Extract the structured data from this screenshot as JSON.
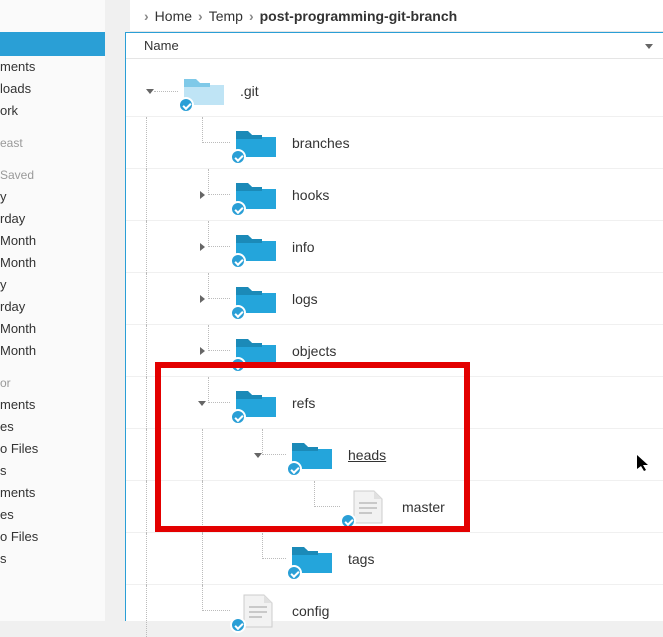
{
  "breadcrumb": {
    "items": [
      "Home",
      "Temp",
      "post-programming-git-branch"
    ]
  },
  "sidebar": {
    "sel": "",
    "g1": [
      "ments",
      "loads",
      "ork"
    ],
    "h1": "east",
    "h2": "Saved",
    "g2": [
      "y",
      "rday",
      "Month",
      "Month",
      "y",
      "rday",
      "Month",
      "Month"
    ],
    "h3": "or",
    "g3": [
      "ments",
      "es",
      "o Files",
      "s",
      "ments",
      "es",
      "o Files",
      "s"
    ]
  },
  "header": {
    "name": "Name"
  },
  "tree": {
    "git": ".git",
    "branches": "branches",
    "hooks": "hooks",
    "info": "info",
    "logs": "logs",
    "objects": "objects",
    "refs": "refs",
    "heads": "heads",
    "master": "master",
    "tags": "tags",
    "config": "config"
  }
}
